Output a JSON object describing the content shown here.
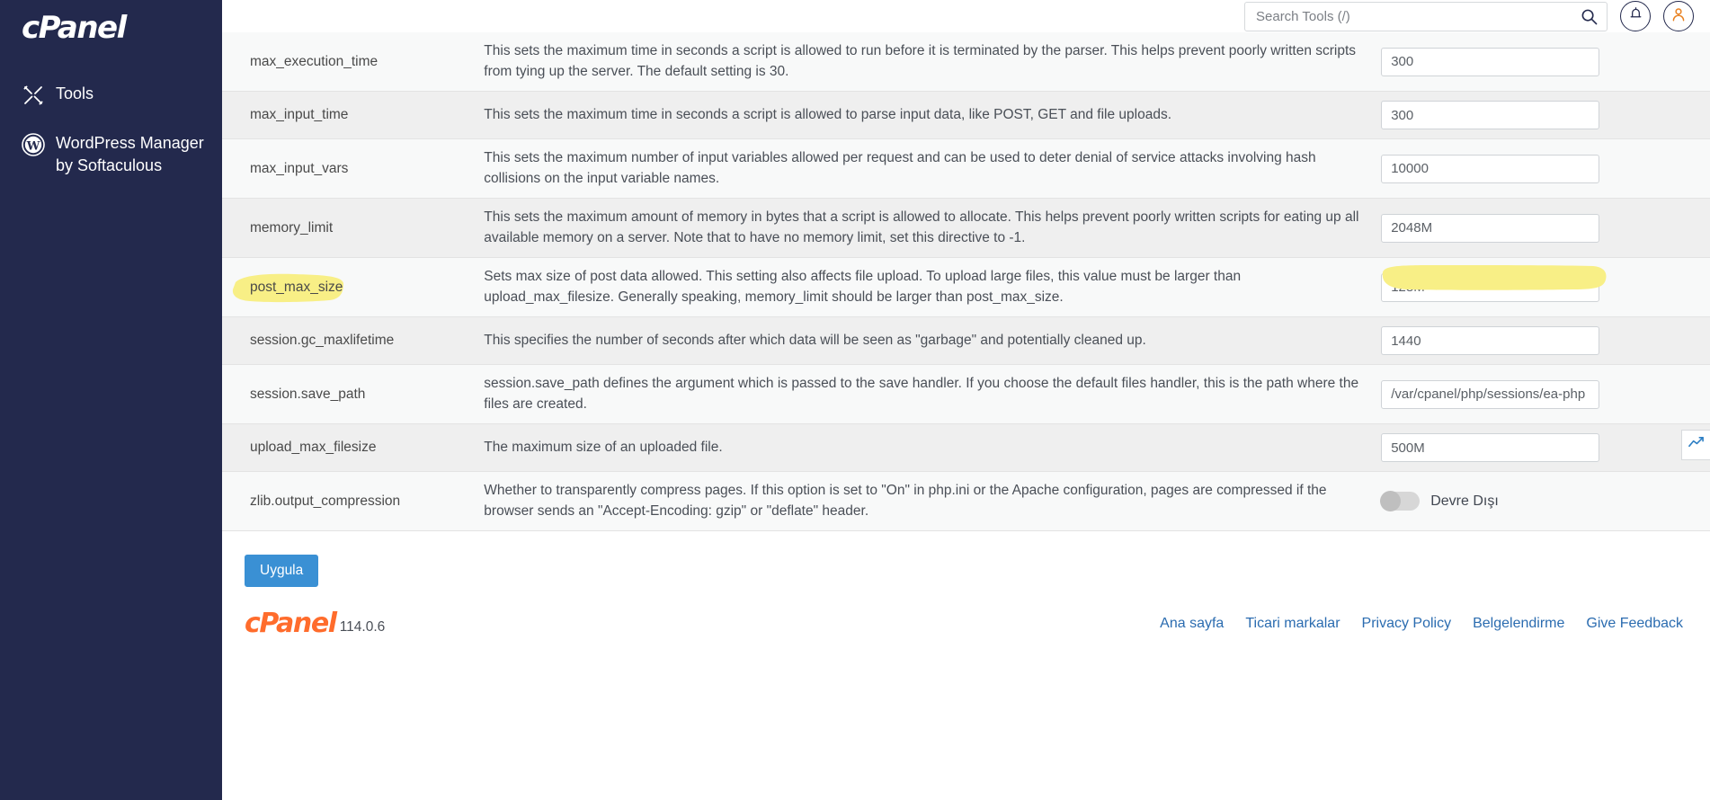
{
  "sidebar": {
    "logo": "cPanel",
    "items": [
      {
        "label": "Tools",
        "icon": "tools-icon"
      },
      {
        "label": "WordPress Manager by Softaculous",
        "icon": "wordpress-icon"
      }
    ]
  },
  "header": {
    "search": {
      "placeholder": "Search Tools (/)",
      "value": ""
    },
    "search_icon": "search-icon",
    "notifications_icon": "bell-icon",
    "account_icon": "user-icon"
  },
  "table": {
    "rows": [
      {
        "name": "max_execution_time",
        "description": "This sets the maximum time in seconds a script is allowed to run before it is terminated by the parser. This helps prevent poorly written scripts from tying up the server. The default setting is 30.",
        "value": "300",
        "type": "text",
        "highlighted": false
      },
      {
        "name": "max_input_time",
        "description": "This sets the maximum time in seconds a script is allowed to parse input data, like POST, GET and file uploads.",
        "value": "300",
        "type": "text",
        "highlighted": false
      },
      {
        "name": "max_input_vars",
        "description": "This sets the maximum number of input variables allowed per request and can be used to deter denial of service attacks involving hash collisions on the input variable names.",
        "value": "10000",
        "type": "text",
        "highlighted": false
      },
      {
        "name": "memory_limit",
        "description": "This sets the maximum amount of memory in bytes that a script is allowed to allocate. This helps prevent poorly written scripts for eating up all available memory on a server. Note that to have no memory limit, set this directive to -1.",
        "value": "2048M",
        "type": "text",
        "highlighted": false
      },
      {
        "name": "post_max_size",
        "description": "Sets max size of post data allowed. This setting also affects file upload. To upload large files, this value must be larger than upload_max_filesize. Generally speaking, memory_limit should be larger than post_max_size.",
        "value": "128M",
        "type": "text",
        "highlighted": true
      },
      {
        "name": "session.gc_maxlifetime",
        "description": "This specifies the number of seconds after which data will be seen as \"garbage\" and potentially cleaned up.",
        "value": "1440",
        "type": "text",
        "highlighted": false
      },
      {
        "name": "session.save_path",
        "description": "session.save_path defines the argument which is passed to the save handler. If you choose the default files handler, this is the path where the files are created.",
        "value": "/var/cpanel/php/sessions/ea-php",
        "type": "text",
        "highlighted": false
      },
      {
        "name": "upload_max_filesize",
        "description": "The maximum size of an uploaded file.",
        "value": "500M",
        "type": "text",
        "highlighted": false
      },
      {
        "name": "zlib.output_compression",
        "description": "Whether to transparently compress pages. If this option is set to \"On\" in php.ini or the Apache configuration, pages are compressed if the browser sends an \"Accept-Encoding: gzip\" or \"deflate\" header.",
        "value": "Devre Dışı",
        "type": "toggle",
        "toggle_on": false,
        "highlighted": false
      }
    ]
  },
  "actions": {
    "apply_label": "Uygula"
  },
  "footer": {
    "logo": "cPanel",
    "version": "114.0.6",
    "links": [
      "Ana sayfa",
      "Ticari markalar",
      "Privacy Policy",
      "Belgelendirme",
      "Give Feedback"
    ]
  },
  "side_widget": {
    "icon": "chart-line-icon"
  },
  "colors": {
    "sidebar_bg": "#23294d",
    "brand_orange": "#ff6c2c",
    "primary_button": "#3a90d4",
    "link_blue": "#2b6cb0",
    "highlight_yellow": "#f8ef86"
  }
}
